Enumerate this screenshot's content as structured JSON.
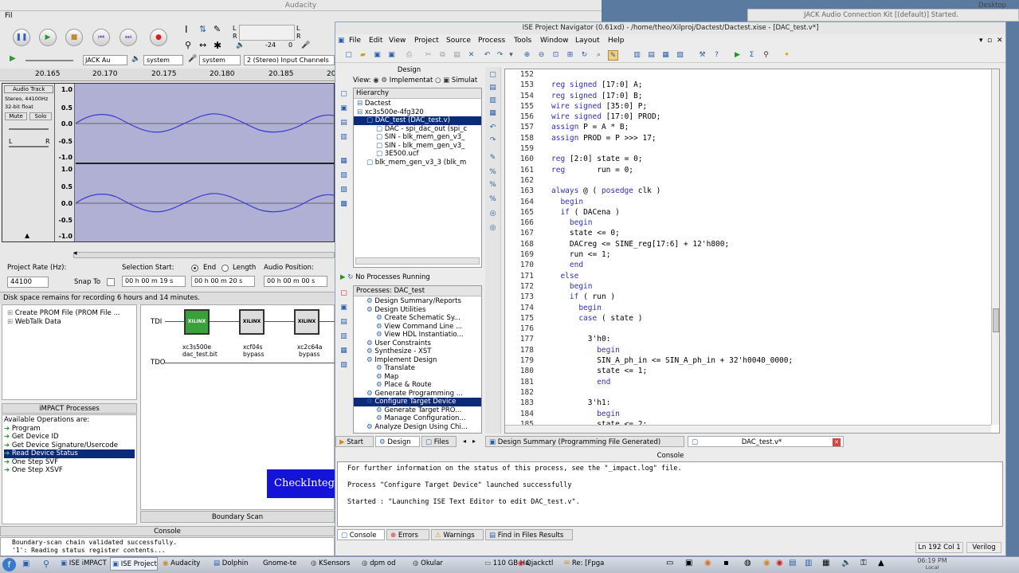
{
  "audacity": {
    "title": "Audacity",
    "menu": "Fil",
    "meter_ticks": [
      "-24",
      "0"
    ],
    "host": "JACK Au",
    "device_out": "system",
    "device_in": "system",
    "channels": "2 (Stereo) Input Channels",
    "ruler": [
      "20.165",
      "20.170",
      "20.175",
      "20.180",
      "20.185",
      "20"
    ],
    "track": {
      "name": "Audio Track",
      "info1": "Stereo, 44100Hz",
      "info2": "32-bit float",
      "mute": "Mute",
      "solo": "Solo",
      "left": "L",
      "right": "R"
    },
    "scale": [
      "1.0",
      "0.5",
      "0.0",
      "-0.5",
      "-1.0",
      "1.0",
      "0.5",
      "0.0",
      "-0.5",
      "-1.0"
    ],
    "project_rate_label": "Project Rate (Hz):",
    "project_rate": "44100",
    "snap_to": "Snap To",
    "selection_start": "Selection Start:",
    "end_label": "End",
    "length_label": "Length",
    "audio_position": "Audio Position:",
    "t1": "00 h 00 m 19 s",
    "t2": "00 h 00 m 20 s",
    "t3": "00 h 00 m 00 s",
    "status": "Disk space remains for recording 6 hours and 14 minutes."
  },
  "impact": {
    "tree": [
      "Create PROM File (PROM File ...",
      "WebTalk Data"
    ],
    "tdi": "TDI",
    "tdo": "TDO",
    "chips": [
      {
        "name": "xc3s500e",
        "sub": "dac_test.bit"
      },
      {
        "name": "xcf04s",
        "sub": "bypass"
      },
      {
        "name": "xc2c64a",
        "sub": "bypass"
      }
    ],
    "processes_title": "iMPACT Processes",
    "available": "Available Operations are:",
    "ops": [
      "Program",
      "Get Device ID",
      "Get Device Signature/Usercode",
      "Read Device Status",
      "One Step SVF",
      "One Step XSVF"
    ],
    "check_btn": "CheckInteg",
    "boundary_scan": "Boundary Scan",
    "console_title": "Console",
    "console_lines": [
      "Boundary-scan chain validated successfully.",
      "'1': Reading status register contents..."
    ]
  },
  "jack": {
    "title": "JACK Audio Connection Kit [(default)] Started.",
    "desktop": "Desktop"
  },
  "ise": {
    "title": "ISE Project Navigator (0.61xd) - /home/theo/Xilproj/Dactest/Dactest.xise - [DAC_test.v*]",
    "menu": [
      "File",
      "Edit",
      "View",
      "Project",
      "Source",
      "Process",
      "Tools",
      "Window",
      "Layout",
      "Help"
    ],
    "design_title": "Design",
    "view_label": "View:",
    "impl_label": "Implementat",
    "sim_label": "Simulat",
    "hierarchy_label": "Hierarchy",
    "hierarchy": [
      {
        "text": "Dactest",
        "indent": 0
      },
      {
        "text": "xc3s500e-4fg320",
        "indent": 0
      },
      {
        "text": "DAC_test (DAC_test.v)",
        "indent": 1,
        "selected": true
      },
      {
        "text": "DAC - spi_dac_out (spi_c",
        "indent": 2
      },
      {
        "text": "SIN - blk_mem_gen_v3_",
        "indent": 2
      },
      {
        "text": "SIN - blk_mem_gen_v3_",
        "indent": 2
      },
      {
        "text": "3E500.ucf",
        "indent": 2
      },
      {
        "text": "blk_mem_gen_v3_3 (blk_m",
        "indent": 1
      }
    ],
    "no_processes": "No Processes Running",
    "processes_label": "Processes: DAC_test",
    "processes": [
      {
        "text": "Design Summary/Reports",
        "indent": 1
      },
      {
        "text": "Design Utilities",
        "indent": 1
      },
      {
        "text": "Create Schematic Sy...",
        "indent": 2
      },
      {
        "text": "View Command Line ...",
        "indent": 2
      },
      {
        "text": "View HDL Instantiatio...",
        "indent": 2
      },
      {
        "text": "User Constraints",
        "indent": 1
      },
      {
        "text": "Synthesize - XST",
        "indent": 1
      },
      {
        "text": "Implement Design",
        "indent": 1
      },
      {
        "text": "Translate",
        "indent": 2
      },
      {
        "text": "Map",
        "indent": 2
      },
      {
        "text": "Place & Route",
        "indent": 2
      },
      {
        "text": "Generate Programming ...",
        "indent": 1
      },
      {
        "text": "Configure Target Device",
        "indent": 1,
        "selected": true
      },
      {
        "text": "Generate Target PRO...",
        "indent": 2
      },
      {
        "text": "Manage Configuration...",
        "indent": 2
      },
      {
        "text": "Analyze Design Using Chi...",
        "indent": 1
      }
    ],
    "left_tabs": [
      "Start",
      "Design",
      "Files"
    ],
    "code": [
      {
        "n": "152",
        "t": ""
      },
      {
        "n": "153",
        "t": "reg signed [17:0] A;"
      },
      {
        "n": "154",
        "t": "reg signed [17:0] B;"
      },
      {
        "n": "155",
        "t": "wire signed [35:0] P;"
      },
      {
        "n": "156",
        "t": "wire signed [17:0] PROD;"
      },
      {
        "n": "157",
        "t": "assign P = A * B;"
      },
      {
        "n": "158",
        "t": "assign PROD = P >>> 17;"
      },
      {
        "n": "159",
        "t": ""
      },
      {
        "n": "160",
        "t": "reg [2:0] state = 0;"
      },
      {
        "n": "161",
        "t": "reg       run = 0;"
      },
      {
        "n": "162",
        "t": ""
      },
      {
        "n": "163",
        "t": "always @ ( posedge clk )"
      },
      {
        "n": "164",
        "t": "  begin"
      },
      {
        "n": "165",
        "t": "  if ( DACena )"
      },
      {
        "n": "166",
        "t": "    begin"
      },
      {
        "n": "167",
        "t": "    state <= 0;"
      },
      {
        "n": "168",
        "t": "    DACreg <= SINE_reg[17:6] + 12'h800;"
      },
      {
        "n": "169",
        "t": "    run <= 1;"
      },
      {
        "n": "170",
        "t": "    end"
      },
      {
        "n": "171",
        "t": "  else"
      },
      {
        "n": "172",
        "t": "    begin"
      },
      {
        "n": "173",
        "t": "    if ( run )"
      },
      {
        "n": "174",
        "t": "      begin"
      },
      {
        "n": "175",
        "t": "      case ( state )"
      },
      {
        "n": "176",
        "t": ""
      },
      {
        "n": "177",
        "t": "        3'h0:"
      },
      {
        "n": "178",
        "t": "          begin"
      },
      {
        "n": "179",
        "t": "          SIN_A_ph_in <= SIN_A_ph_in + 32'h0040_0000;"
      },
      {
        "n": "180",
        "t": "          state <= 1;"
      },
      {
        "n": "181",
        "t": "          end"
      },
      {
        "n": "182",
        "t": ""
      },
      {
        "n": "183",
        "t": "        3'h1:"
      },
      {
        "n": "184",
        "t": "          begin"
      },
      {
        "n": "185",
        "t": "          state <= 2;"
      }
    ],
    "editor_tabs": [
      "Design Summary (Programming File Generated)",
      "DAC_test.v*"
    ],
    "console_title": "Console",
    "console_lines": [
      "For further information on the status of this process, see the \"_impact.log\" file.",
      "",
      "Process \"Configure Target Device\" launched successfully",
      "",
      "Started : \"Launching ISE Text Editor to edit DAC_test.v\"."
    ],
    "bottom_tabs": [
      "Console",
      "Errors",
      "Warnings",
      "Find in Files Results"
    ],
    "status_pos": "Ln 192 Col 1",
    "status_lang": "Verilog"
  },
  "taskbar": {
    "items": [
      "ISE iMPACT",
      "ISE Project",
      "Audacity",
      "Dolphin",
      "Gnome-te",
      "KSensors",
      "dpm od",
      "Okular",
      "110 GB Ha",
      "Qjackctl",
      "Re: [Fpga"
    ],
    "clock": "06:19 PM",
    "clock_sub": "Local"
  }
}
